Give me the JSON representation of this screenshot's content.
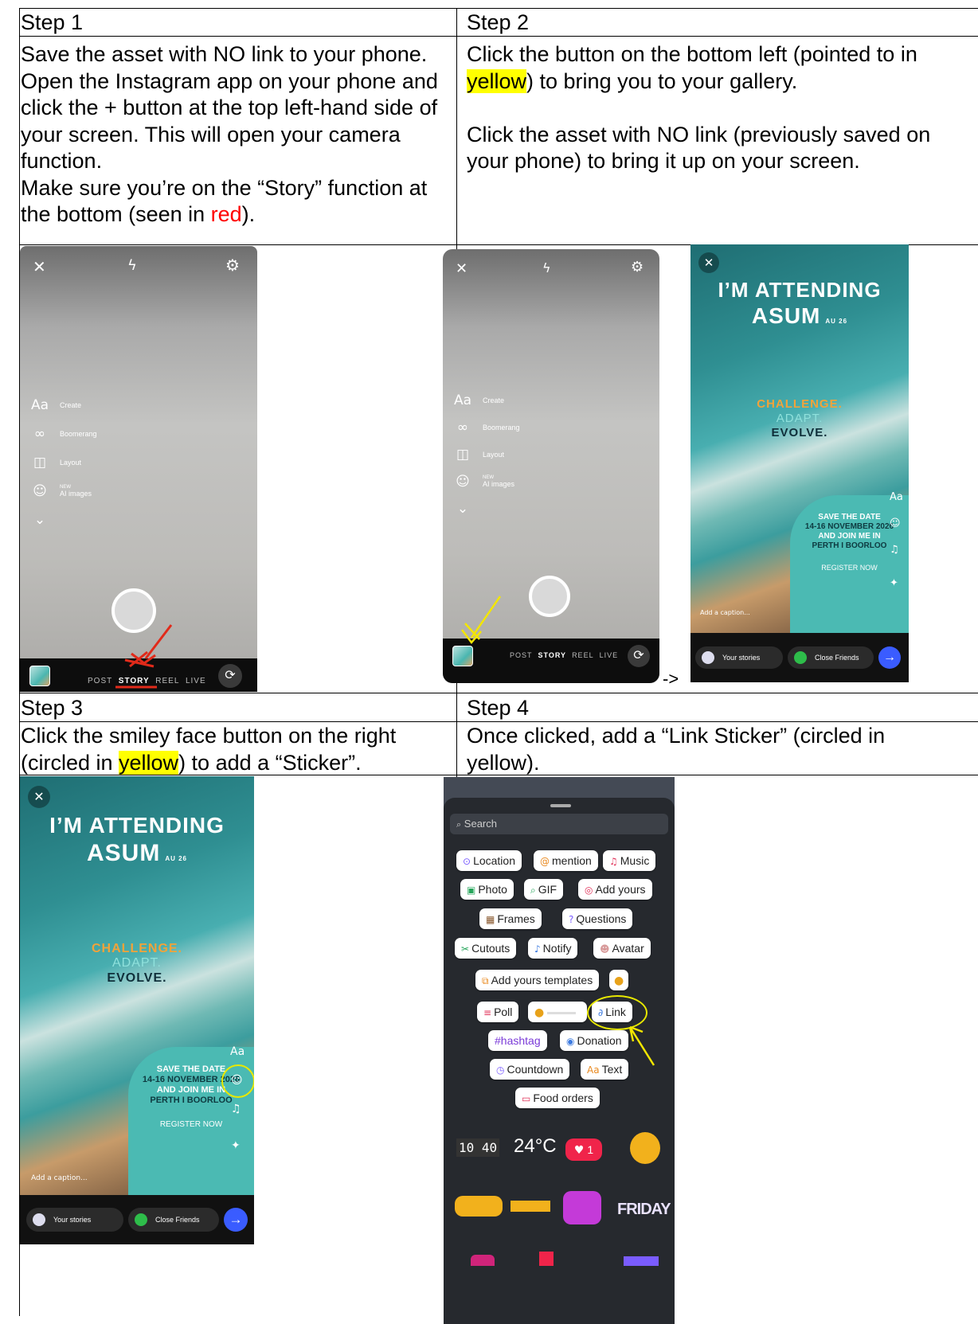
{
  "cells": {
    "step1": {
      "header": "Step 1",
      "text_a": "Save the asset with NO link to your phone.",
      "text_b": "Open the Instagram app on your phone and click the + button at the top left-hand side of your screen. This will open your camera function.",
      "text_c": "Make sure you’re on the “Story” function at the bottom (seen in ",
      "text_c_red": "red",
      "text_c_end": ")."
    },
    "step2": {
      "header": "Step 2",
      "text_a": "Click the button on the bottom left (pointed to in ",
      "text_a_hl": "yellow",
      "text_a_end": ") to bring you to your gallery.",
      "text_b": "Click the asset with NO link (previously saved on your phone) to bring it up on your screen.",
      "arrow": "->"
    },
    "step3": {
      "header": "Step 3",
      "text_a": "Click the smiley face button on the right (circled in ",
      "text_a_hl": "yellow",
      "text_a_end": ") to add a “Sticker”."
    },
    "step4": {
      "header": "Step 4",
      "text_a": "Once clicked, add a “Link Sticker” (circled in yellow)."
    }
  },
  "camera": {
    "menu": [
      {
        "icon": "Aa",
        "label": "Create"
      },
      {
        "icon": "∞",
        "label": "Boomerang"
      },
      {
        "icon": "◫",
        "label": "Layout"
      },
      {
        "icon": "☺",
        "label": "AI images",
        "badge": "NEW"
      },
      {
        "icon": "⌄",
        "label": ""
      }
    ],
    "modes": [
      "POST",
      "STORY",
      "REEL",
      "LIVE"
    ]
  },
  "story": {
    "line1": "I’M ATTENDING",
    "line2": "ASUM",
    "tag": "AU 26",
    "challenge": "CHALLENGE.",
    "adapt": "ADAPT.",
    "evolve": "EVOLVE.",
    "save": "SAVE THE DATE",
    "dates": "14-16 NOVEMBER 2026",
    "join": "AND JOIN ME IN",
    "city": "PERTH I BOORLOO",
    "register": "REGISTER NOW",
    "caption": "Add a caption...",
    "your_stories": "Your stories",
    "close_friends": "Close Friends",
    "aa": "Aa"
  },
  "stickers": {
    "search": "Search",
    "chips": [
      {
        "label": "Location",
        "icon": "⊙"
      },
      {
        "label": "mention",
        "icon": "@"
      },
      {
        "label": "Music",
        "icon": "♫"
      },
      {
        "label": "Photo",
        "icon": "▣"
      },
      {
        "label": "GIF",
        "icon": "⌕"
      },
      {
        "label": "Add yours",
        "icon": "◎"
      },
      {
        "label": "Frames",
        "icon": "▦"
      },
      {
        "label": "Questions",
        "icon": "?"
      },
      {
        "label": "Cutouts",
        "icon": "✂"
      },
      {
        "label": "Notify",
        "icon": "♪"
      },
      {
        "label": "Avatar",
        "icon": "☻"
      },
      {
        "label": "Add yours templates",
        "icon": "⧉"
      },
      {
        "label": "Poll",
        "icon": "≡"
      },
      {
        "label": "Link",
        "icon": "∂"
      },
      {
        "label": "#hashtag",
        "icon": ""
      },
      {
        "label": "Donation",
        "icon": "◉"
      },
      {
        "label": "Countdown",
        "icon": "◷"
      },
      {
        "label": "Text",
        "icon": "Aa"
      },
      {
        "label": "Food orders",
        "icon": "▭"
      }
    ],
    "time": "10 40",
    "temp": "24°C",
    "likes": "1",
    "friday": "FRIDAY"
  }
}
